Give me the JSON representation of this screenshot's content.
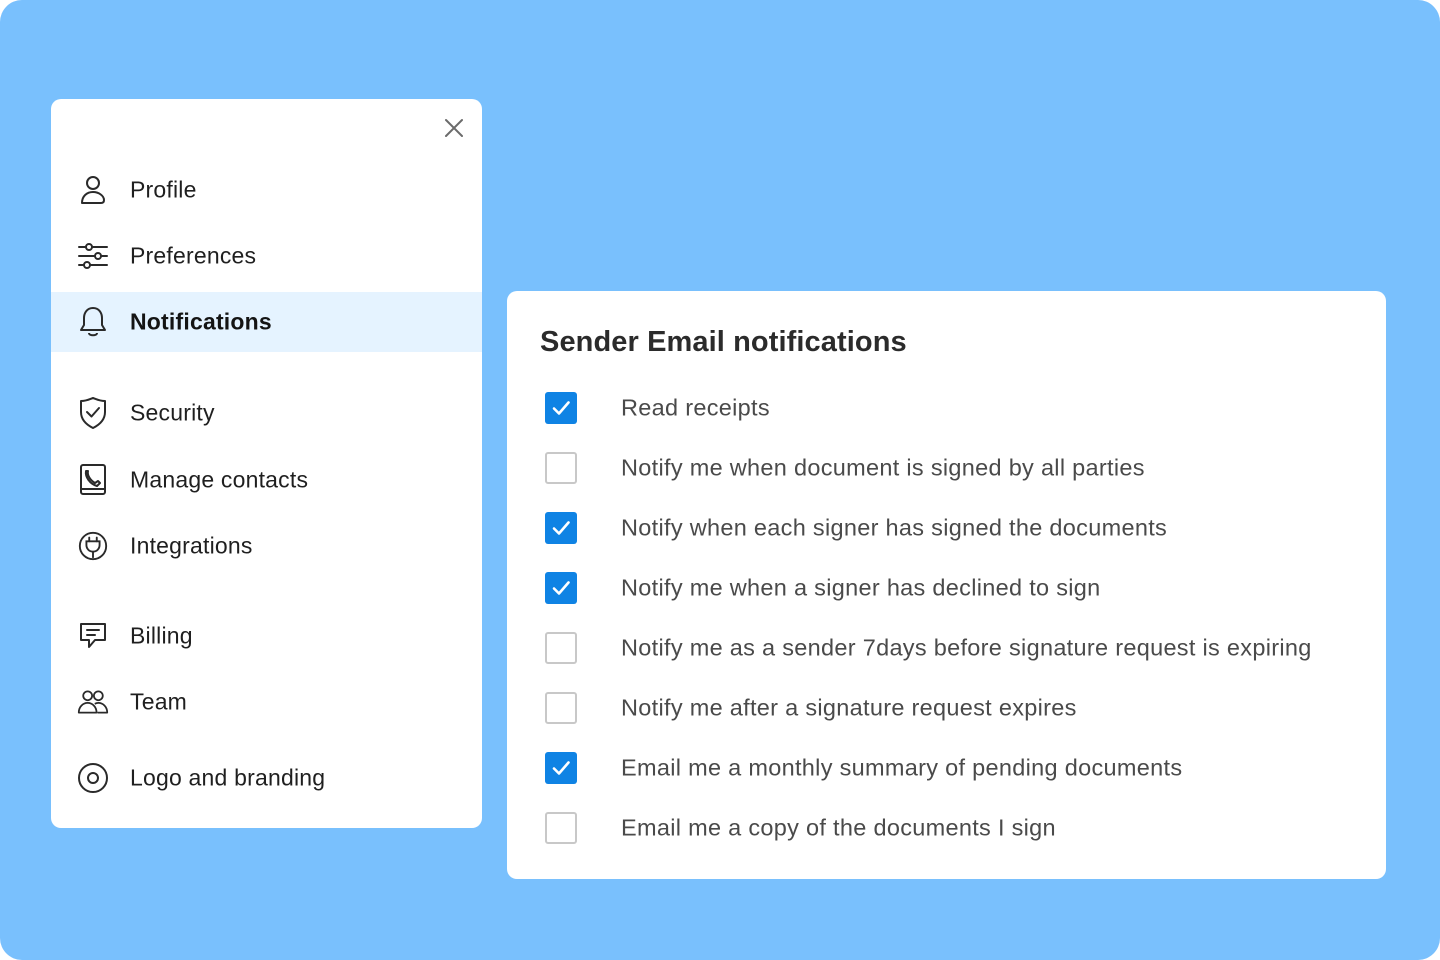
{
  "menu": {
    "close_icon": "close-icon",
    "items": [
      {
        "label": "Profile",
        "icon": "user-icon",
        "active": false
      },
      {
        "label": "Preferences",
        "icon": "sliders-icon",
        "active": false
      },
      {
        "label": "Notifications",
        "icon": "bell-icon",
        "active": true
      },
      {
        "label": "Security",
        "icon": "shield-check-icon",
        "active": false
      },
      {
        "label": "Manage contacts",
        "icon": "contact-book-icon",
        "active": false
      },
      {
        "label": "Integrations",
        "icon": "plug-icon",
        "active": false
      },
      {
        "label": "Billing",
        "icon": "receipt-icon",
        "active": false
      },
      {
        "label": "Team",
        "icon": "team-icon",
        "active": false
      },
      {
        "label": "Logo and branding",
        "icon": "brand-circle-icon",
        "active": false
      }
    ]
  },
  "notifications": {
    "title": "Sender Email notifications",
    "options": [
      {
        "label": "Read receipts",
        "checked": true
      },
      {
        "label": "Notify me when document is signed by all parties",
        "checked": false
      },
      {
        "label": "Notify when each signer has signed the documents",
        "checked": true
      },
      {
        "label": "Notify me when a signer has declined to sign",
        "checked": true
      },
      {
        "label": "Notify me as a sender 7days before signature request is expiring",
        "checked": false
      },
      {
        "label": "Notify me after a signature request expires",
        "checked": false
      },
      {
        "label": "Email me a monthly summary of pending documents",
        "checked": true
      },
      {
        "label": "Email me a copy of the documents I sign",
        "checked": false
      }
    ]
  },
  "colors": {
    "background": "#79c0fd",
    "accent": "#0f83e4",
    "active_row": "#e5f3ff"
  }
}
